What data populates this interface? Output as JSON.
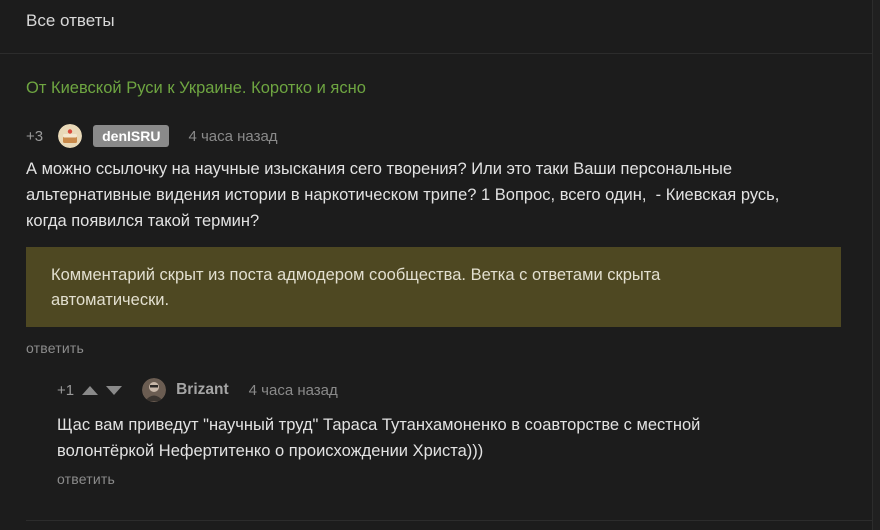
{
  "header": {
    "title": "Все ответы"
  },
  "post": {
    "title": "От Киевской Руси к Украине. Коротко и ясно"
  },
  "comment": {
    "rating": "+3",
    "author": "denISRU",
    "time": "4 часа назад",
    "text": "А можно ссылочку на научные изыскания сего творения? Или это таки Ваши персональные\nальтернативные видения истории в наркотическом трипе? 1 Вопрос, всего один,  - Киевская русь,\nкогда появился такой термин?",
    "hidden_notice": "Комментарий скрыт из поста адмодером сообщества. Ветка с ответами скрыта\nавтоматически.",
    "reply_label": "ответить"
  },
  "child_comment": {
    "rating": "+1",
    "author": "Brizant",
    "time": "4 часа назад",
    "text": "Щас вам приведут \"научный труд\" Тараса Тутанхамоненко в соавторстве с местной\nволонтёркой Нефертитенко о происхождении Христа)))",
    "reply_label": "ответить"
  },
  "colors": {
    "background": "#1c1c1c",
    "post_link": "#6ea541",
    "hidden_box": "#4e4822",
    "author_badge": "#8a8a8a"
  },
  "icons": [
    "avatar-cake",
    "avatar-photo",
    "vote-up-icon",
    "vote-down-icon"
  ]
}
